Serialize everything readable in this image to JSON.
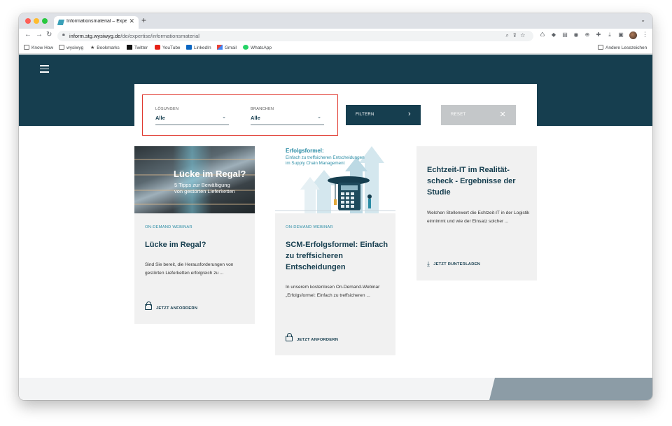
{
  "browser": {
    "tab_title": "Informationsmaterial – Expertise",
    "tab_close": "✕",
    "new_tab": "+",
    "tabs_menu": "⌄",
    "url_host": "inform.stg.wysiwyg.de",
    "url_path": "/de/expertise/informationsmaterial",
    "bookmarks": [
      {
        "label": "Know How",
        "icon": "folder-icon"
      },
      {
        "label": "wysiwyg",
        "icon": "folder-icon"
      },
      {
        "label": "Bookmarks",
        "icon": "star-icon"
      },
      {
        "label": "Twitter",
        "icon": "x-icon"
      },
      {
        "label": "YouTube",
        "icon": "youtube-icon"
      },
      {
        "label": "LinkedIn",
        "icon": "linkedin-icon"
      },
      {
        "label": "Gmail",
        "icon": "gmail-icon"
      },
      {
        "label": "WhatsApp",
        "icon": "whatsapp-icon"
      }
    ],
    "other_bookmarks": "Andere Lesezeichen"
  },
  "filter": {
    "loesungen_label": "LÖSUNGEN",
    "loesungen_value": "Alle",
    "branchen_label": "BRANCHEN",
    "branchen_value": "Alle",
    "filter_button": "FILTERN",
    "reset_button": "RESET"
  },
  "cards": [
    {
      "image_title": "Lücke im Regal?",
      "image_subtitle_1": "5 Tipps zur Bewältigung",
      "image_subtitle_2": "von gestörten Lieferketten",
      "eyebrow": "ON-DEMAND WEBINAR",
      "title": "Lücke im Regal?",
      "desc": "Sind Sie bereit, die Herausforderungen von gestörten Lieferketten erfolgreich zu ...",
      "cta": "JETZT ANFORDERN"
    },
    {
      "image_title": "Erfolgsformel:",
      "image_subtitle_1": "Einfach zu treffsicheren Entscheidungen",
      "image_subtitle_2": "im Supply Chain Management",
      "eyebrow": "ON-DEMAND WEBINAR",
      "title": "SCM-Erfolgsformel: Einfach zu treffsicheren Entscheidungen",
      "desc": "In unserem kostenlosen On-Demand-Webinar „Erfolgsformel: Einfach zu treffsicheren ...",
      "cta": "JETZT ANFORDERN"
    },
    {
      "title": "Echtzeit-IT im Realität-scheck - Ergebnisse der Studie",
      "desc": "Welchen Stellenwert die Echtzeit-IT in der Logistik einnimmt und wie der Einsatz solcher ...",
      "cta": "JETZT RUNTERLADEN"
    }
  ],
  "colors": {
    "brand_dark": "#163e4f",
    "accent": "#2a8ca5",
    "highlight": "#e0392f"
  }
}
